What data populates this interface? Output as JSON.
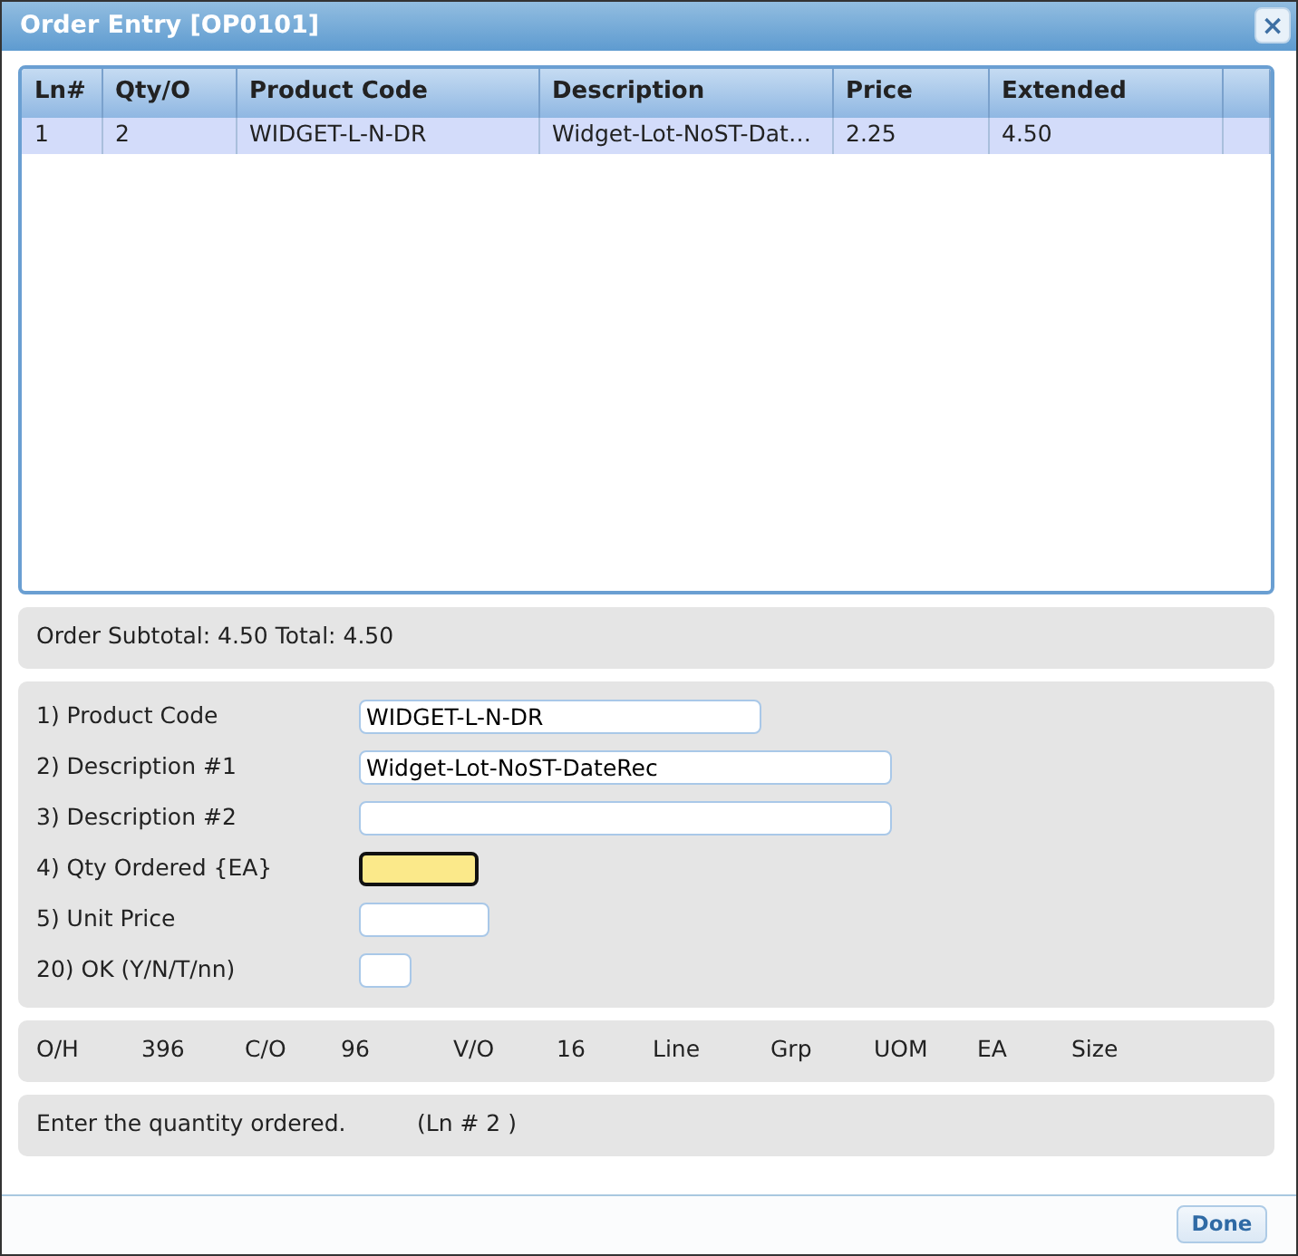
{
  "window": {
    "title": "Order Entry [OP0101]",
    "close": "×"
  },
  "table": {
    "columns": [
      "Ln#",
      "Qty/O",
      "Product Code",
      "Description",
      "Price",
      "Extended"
    ],
    "rows": [
      {
        "selected": true,
        "cells": [
          "1",
          "2",
          "WIDGET-L-N-DR",
          "Widget-Lot-NoST-Dat…",
          "2.25",
          "4.50"
        ]
      }
    ]
  },
  "totals": "Order Subtotal: 4.50 Total: 4.50",
  "form": [
    {
      "label": "1) Product Code",
      "value": "WIDGET-L-N-DR",
      "focused": false
    },
    {
      "label": "2) Description #1",
      "value": "Widget-Lot-NoST-DateRec",
      "focused": false
    },
    {
      "label": "3) Description #2",
      "focused": false
    },
    {
      "label": "4) Qty Ordered {EA}",
      "focused": true
    },
    {
      "label": "5) Unit Price",
      "focused": false
    },
    {
      "label": "20) OK (Y/N/T/nn)",
      "focused": false
    }
  ],
  "info": [
    "O/H",
    "396",
    "C/O",
    "96",
    "V/O",
    "16",
    "Line",
    "Grp",
    "UOM",
    "EA",
    "Size"
  ],
  "status": {
    "message": "Enter the quantity ordered.",
    "line": "(Ln # 2 )"
  },
  "buttons": [
    "Done"
  ]
}
